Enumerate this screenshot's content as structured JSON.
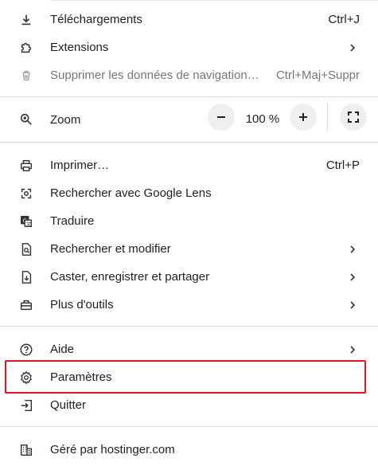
{
  "menu": {
    "downloads": {
      "label": "Téléchargements",
      "shortcut": "Ctrl+J",
      "icon": "download-icon"
    },
    "extensions": {
      "label": "Extensions",
      "icon": "puzzle-icon"
    },
    "clear_data": {
      "label": "Supprimer les données de navigation…",
      "shortcut": "Ctrl+Maj+Suppr",
      "icon": "trash-icon"
    },
    "zoom": {
      "label": "Zoom",
      "level": "100 %",
      "minus": "−",
      "plus": "+",
      "icon": "zoom-icon"
    },
    "print": {
      "label": "Imprimer…",
      "shortcut": "Ctrl+P",
      "icon": "printer-icon"
    },
    "lens": {
      "label": "Rechercher avec Google Lens",
      "icon": "lens-icon"
    },
    "translate": {
      "label": "Traduire",
      "icon": "translate-icon"
    },
    "find": {
      "label": "Rechercher et modifier",
      "icon": "find-icon"
    },
    "cast": {
      "label": "Caster, enregistrer et partager",
      "icon": "cast-icon"
    },
    "more_tools": {
      "label": "Plus d'outils",
      "icon": "toolbox-icon"
    },
    "help": {
      "label": "Aide",
      "icon": "help-icon"
    },
    "settings": {
      "label": "Paramètres",
      "icon": "gear-icon"
    },
    "quit": {
      "label": "Quitter",
      "icon": "exit-icon"
    },
    "managed": {
      "label": "Géré par hostinger.com",
      "icon": "building-icon"
    }
  },
  "colors": {
    "highlight": "#e0141b",
    "separator": "#d5dde3",
    "text": "#1f1f1f"
  }
}
